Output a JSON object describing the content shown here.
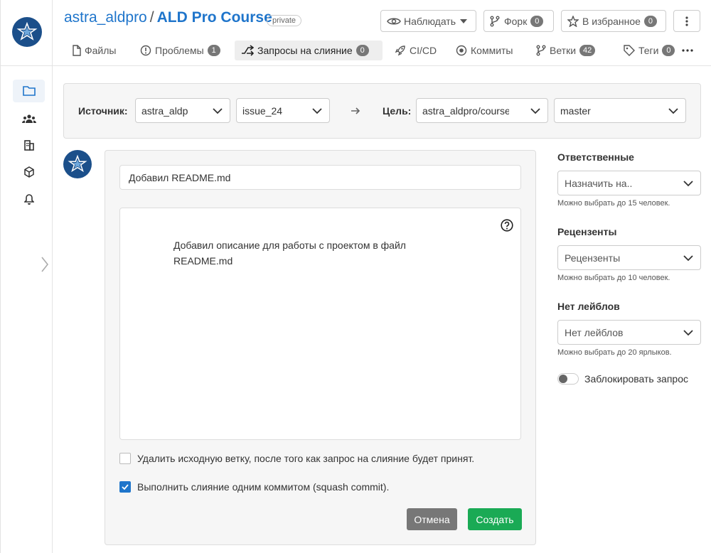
{
  "repo": {
    "owner": "astra_aldpro",
    "separator": "/",
    "name": "ALD Pro Course",
    "visibility": "private"
  },
  "header_buttons": {
    "watch": {
      "label": "Наблюдать"
    },
    "fork": {
      "label": "Форк",
      "count": "0"
    },
    "star": {
      "label": "В избранное",
      "count": "0"
    }
  },
  "tabs": [
    {
      "label": "Файлы",
      "icon": "file-icon"
    },
    {
      "label": "Проблемы",
      "count": "1",
      "icon": "issue-icon"
    },
    {
      "label": "Запросы на слияние",
      "count": "0",
      "icon": "merge-request-icon",
      "active": true
    },
    {
      "label": "CI/CD",
      "icon": "rocket-icon"
    },
    {
      "label": "Коммиты",
      "icon": "commit-icon"
    },
    {
      "label": "Ветки",
      "count": "42",
      "icon": "branch-icon"
    },
    {
      "label": "Теги",
      "count": "0",
      "icon": "tag-icon"
    }
  ],
  "branch_select": {
    "source_label": "Источник:",
    "source_repo": "astra_aldp",
    "source_branch": "issue_24",
    "target_label": "Цель:",
    "target_repo": "astra_aldpro/course",
    "target_branch": "master"
  },
  "form": {
    "title_value": "Добавил README.md",
    "description": "Добавил описание для работы с проектом в файл README.md",
    "delete_branch_label": "Удалить исходную ветку, после того как запрос на слияние будет принят.",
    "delete_branch_checked": false,
    "squash_label": "Выполнить слияние одним коммитом (squash commit).",
    "squash_checked": true,
    "cancel_label": "Отмена",
    "create_label": "Создать"
  },
  "right_panel": {
    "assignees": {
      "title": "Ответственные",
      "placeholder": "Назначить на..",
      "hint": "Можно выбрать до 15 человек."
    },
    "reviewers": {
      "title": "Рецензенты",
      "placeholder": "Рецензенты",
      "hint": "Можно выбрать до 10 человек."
    },
    "labels": {
      "title": "Нет лейблов",
      "placeholder": "Нет лейблов",
      "hint": "Можно выбрать до 20 ярлыков."
    },
    "lock_label": "Заблокировать запрос",
    "lock_on": false
  },
  "colors": {
    "accent": "#1f75cb",
    "create": "#1aaa55",
    "cancel": "#777777",
    "logo": "#1b4f8a"
  }
}
